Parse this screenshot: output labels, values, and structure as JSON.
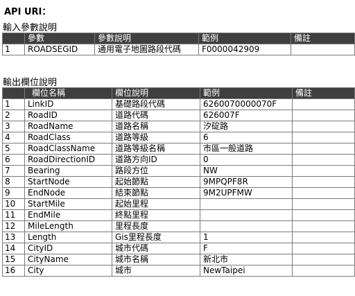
{
  "api_title": "API URI：",
  "input_section": {
    "title": "輸入參數說明",
    "headers": [
      "",
      "參數",
      "參數說明",
      "範例",
      "備註"
    ],
    "rows": [
      [
        "1",
        "ROADSEGID",
        "通用電子地圖路段代碼",
        "F0000042909",
        ""
      ]
    ]
  },
  "output_section": {
    "title": "輸出欄位說明",
    "headers": [
      "",
      "欄位名稱",
      "欄位說明",
      "範例",
      "備註"
    ],
    "rows": [
      [
        "1",
        "LinkID",
        "基礎路段代碼",
        "6260070000070F",
        ""
      ],
      [
        "2",
        "RoadID",
        "道路代碼",
        "626007F",
        ""
      ],
      [
        "3",
        "RoadName",
        "道路名稱",
        "汐碇路",
        ""
      ],
      [
        "4",
        "RoadClass",
        "道路等級",
        "6",
        ""
      ],
      [
        "5",
        "RoadClassName",
        "道路等級名稱",
        "市區一般道路",
        ""
      ],
      [
        "6",
        "RoadDirectionID",
        "道路方向ID",
        "0",
        ""
      ],
      [
        "7",
        "Bearing",
        "路段方位",
        "NW",
        ""
      ],
      [
        "8",
        "StartNode",
        "起始節點",
        "9MPQPF8R",
        ""
      ],
      [
        "9",
        "EndNode",
        "結束節點",
        "9M2UPFMW",
        ""
      ],
      [
        "10",
        "StartMile",
        "起始里程",
        "",
        ""
      ],
      [
        "11",
        "EndMile",
        "終點里程",
        "",
        ""
      ],
      [
        "12",
        "MileLength",
        "里程長度",
        "",
        ""
      ],
      [
        "13",
        "Length",
        "Gis里程長度",
        "1",
        ""
      ],
      [
        "14",
        "CityID",
        "城市代碼",
        "F",
        ""
      ],
      [
        "15",
        "CityName",
        "城市名稱",
        "新北市",
        ""
      ],
      [
        "16",
        "City",
        "城市",
        "NewTaipei",
        ""
      ]
    ]
  }
}
